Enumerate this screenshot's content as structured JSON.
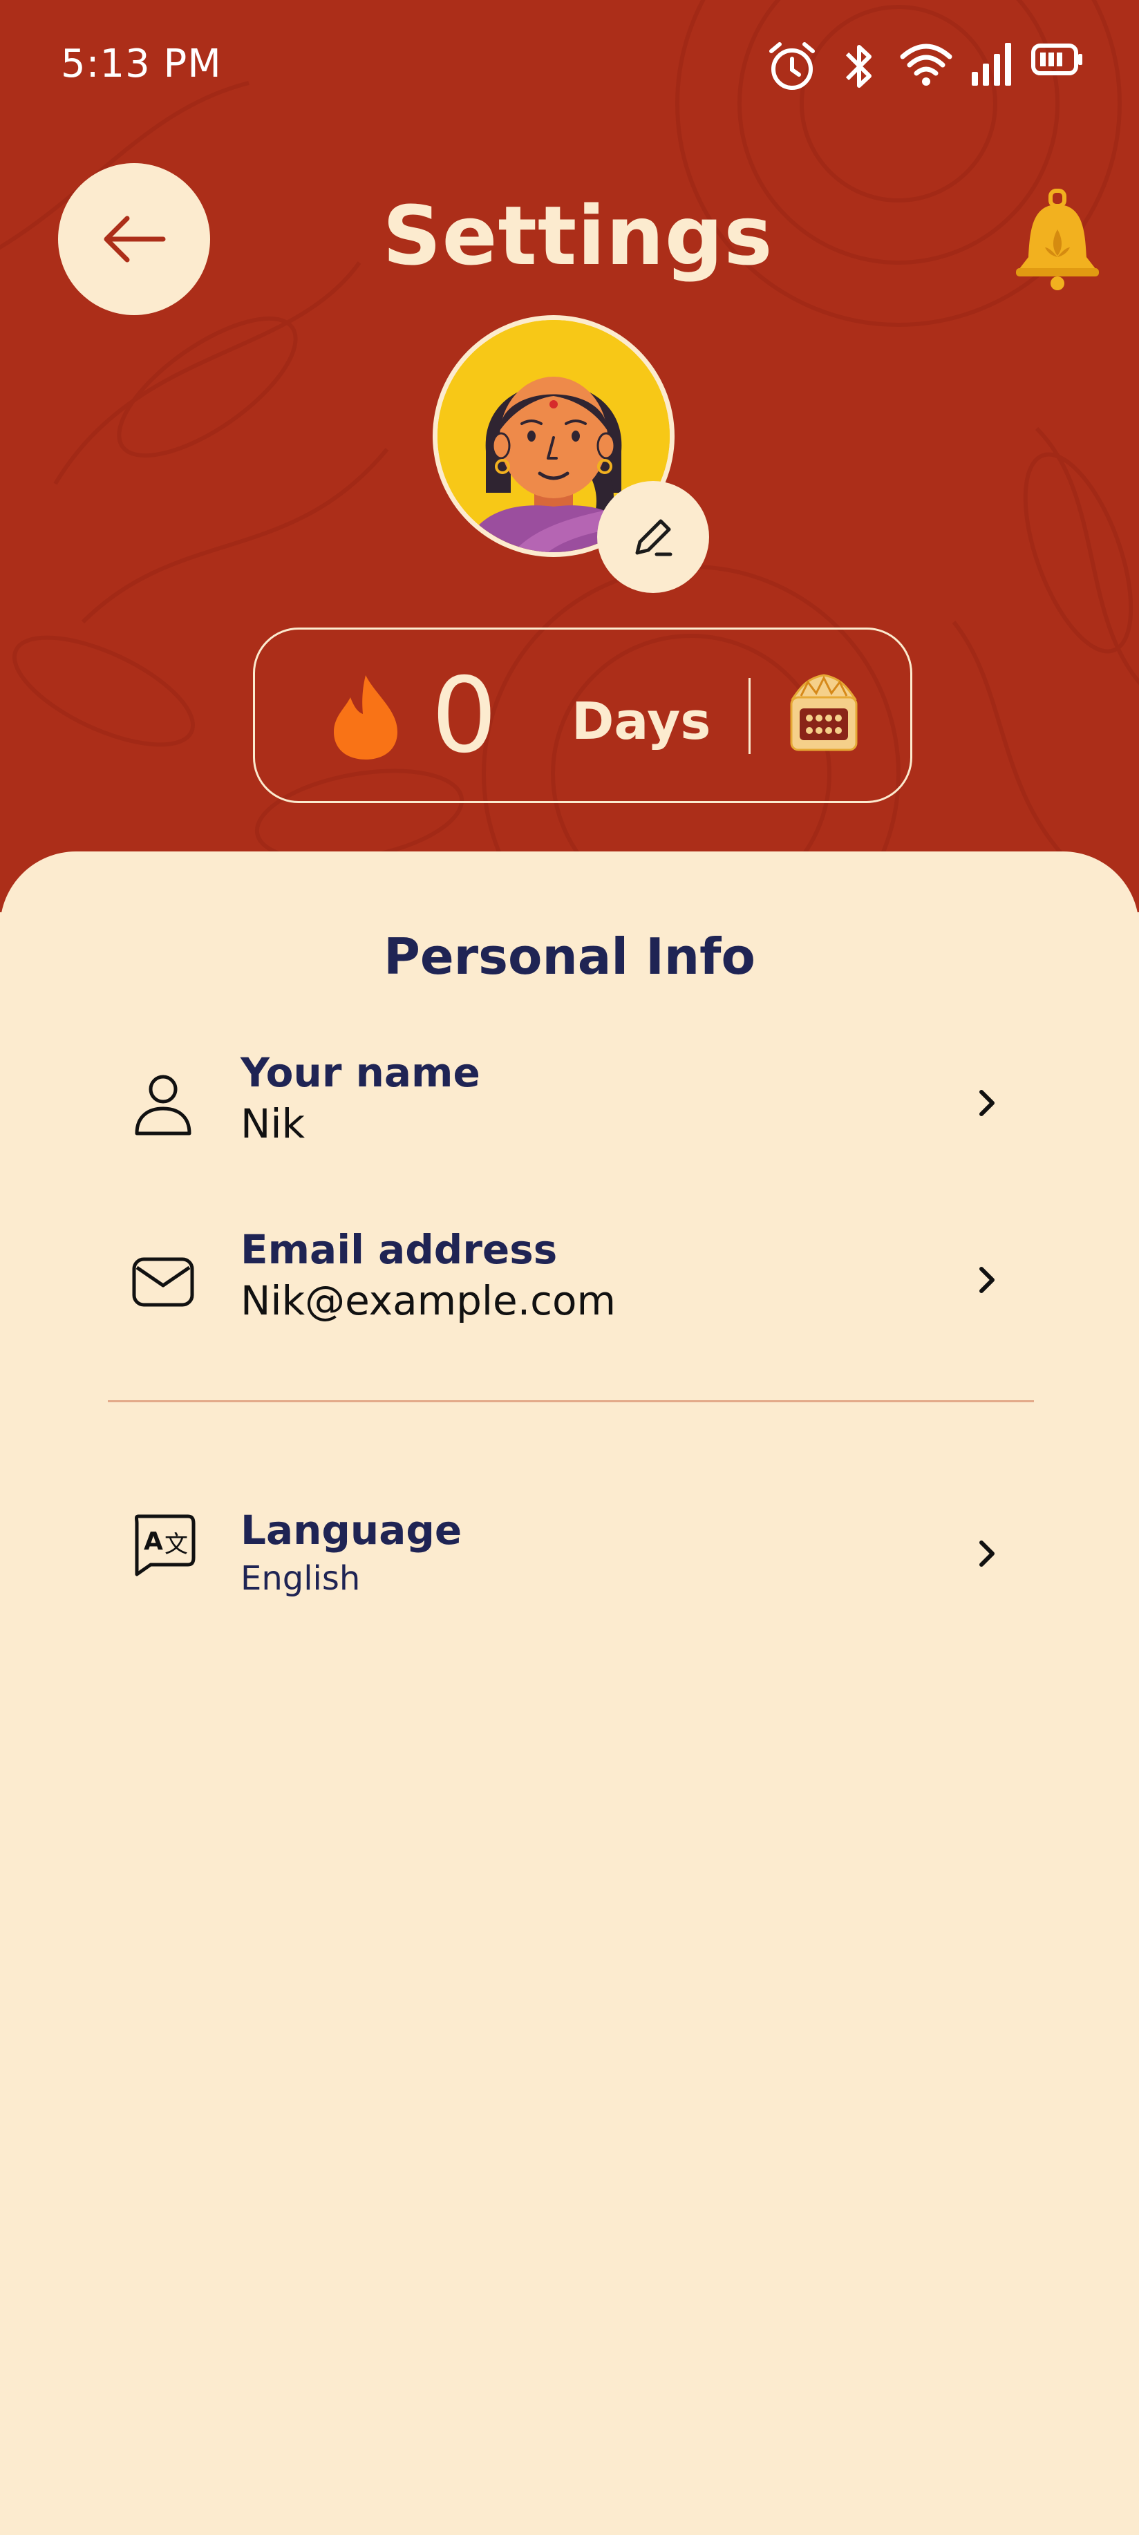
{
  "status_bar": {
    "time": "5:13 PM",
    "icons": [
      "alarm-icon",
      "bluetooth-icon",
      "wifi-icon",
      "signal-icon",
      "battery-icon"
    ]
  },
  "header": {
    "title": "Settings",
    "back_icon": "arrow-left-icon",
    "bell_icon": "bell-icon"
  },
  "streak": {
    "count": "0",
    "unit": "Days"
  },
  "personal_info": {
    "section_title": "Personal Info",
    "name_label": "Your name",
    "name_value": "Nik",
    "email_label": "Email address",
    "email_value": "Nik@example.com",
    "language_label": "Language",
    "language_value": "English"
  },
  "colors": {
    "header_bg": "#ac2e19",
    "cream": "#fcebcf",
    "navy_text": "#1f2454",
    "accent_gold": "#f2b11f",
    "flame": "#f97316",
    "divider": "#e3a989"
  }
}
